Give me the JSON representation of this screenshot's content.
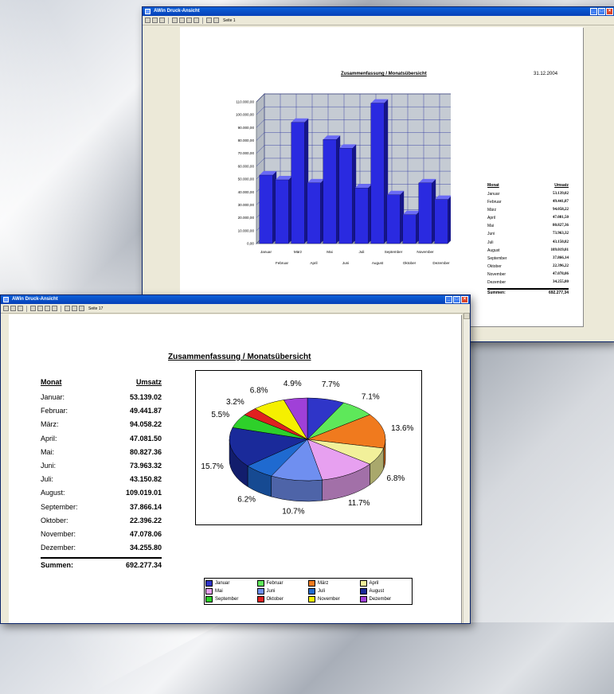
{
  "back_window": {
    "title": "AWin Druck-Ansicht",
    "page_label": "Seite 1",
    "report_title": "Zusammenfassung / Monatsübersicht",
    "date": "31.12.2004",
    "table": {
      "col_month": "Monat",
      "col_sales": "Umsatz",
      "rows": [
        {
          "month": "Januar",
          "value": "53.139,02"
        },
        {
          "month": "Februar",
          "value": "49.441,87"
        },
        {
          "month": "März",
          "value": "94.058,22"
        },
        {
          "month": "April",
          "value": "47.081,50"
        },
        {
          "month": "Mai",
          "value": "80.827,36"
        },
        {
          "month": "Juni",
          "value": "73.963,32"
        },
        {
          "month": "Juli",
          "value": "43.150,82"
        },
        {
          "month": "August",
          "value": "109.019,01"
        },
        {
          "month": "September",
          "value": "37.866,14"
        },
        {
          "month": "Oktober",
          "value": "22.396,22"
        },
        {
          "month": "November",
          "value": "47.078,06"
        },
        {
          "month": "Dezember",
          "value": "34.255,80"
        }
      ],
      "sum_label": "Summen:",
      "sum_value": "692.277,34"
    }
  },
  "front_window": {
    "title": "AWin Druck-Ansicht",
    "page_label": "Seite 17",
    "report_title": "Zusammenfassung / Monatsübersicht",
    "table": {
      "col_month": "Monat",
      "col_sales": "Umsatz",
      "rows": [
        {
          "month": "Januar:",
          "value": "53.139.02"
        },
        {
          "month": "Februar:",
          "value": "49.441.87"
        },
        {
          "month": "März:",
          "value": "94.058.22"
        },
        {
          "month": "April:",
          "value": "47.081.50"
        },
        {
          "month": "Mai:",
          "value": "80.827.36"
        },
        {
          "month": "Juni:",
          "value": "73.963.32"
        },
        {
          "month": "Juli:",
          "value": "43.150.82"
        },
        {
          "month": "August:",
          "value": "109.019.01"
        },
        {
          "month": "September:",
          "value": "37.866.14"
        },
        {
          "month": "Oktober:",
          "value": "22.396.22"
        },
        {
          "month": "November:",
          "value": "47.078.06"
        },
        {
          "month": "Dezember:",
          "value": "34.255.80"
        }
      ],
      "sum_label": "Summen:",
      "sum_value": "692.277.34"
    },
    "legend": [
      {
        "label": "Januar",
        "color": "#2f35c8"
      },
      {
        "label": "Februar",
        "color": "#5ee85a"
      },
      {
        "label": "März",
        "color": "#f07a1e"
      },
      {
        "label": "April",
        "color": "#f2f09a"
      },
      {
        "label": "Mai",
        "color": "#e7a0f0"
      },
      {
        "label": "Juni",
        "color": "#6f8ff0"
      },
      {
        "label": "Juli",
        "color": "#1f6ad0"
      },
      {
        "label": "August",
        "color": "#1a2a9a"
      },
      {
        "label": "September",
        "color": "#2ed02a"
      },
      {
        "label": "Oktober",
        "color": "#e02020"
      },
      {
        "label": "November",
        "color": "#f5f000"
      },
      {
        "label": "Dezember",
        "color": "#a040d8"
      }
    ]
  },
  "chart_data": [
    {
      "type": "bar",
      "categories": [
        "Januar",
        "Februar",
        "März",
        "April",
        "Mai",
        "Juni",
        "Juli",
        "August",
        "September",
        "Oktober",
        "November",
        "Dezember"
      ],
      "x_tick_labels_row1": [
        "Januar",
        "März",
        "Mai",
        "Juli",
        "September",
        "November"
      ],
      "x_tick_labels_row2": [
        "Februar",
        "April",
        "Juni",
        "August",
        "Oktober",
        "Dezember"
      ],
      "values": [
        53139.02,
        49441.87,
        94058.22,
        47081.5,
        80827.36,
        73963.32,
        43150.82,
        109019.01,
        37866.14,
        22396.22,
        47078.06,
        34255.8
      ],
      "y_ticks": [
        "0,00",
        "10.000,00",
        "20.000,00",
        "30.000,00",
        "40.000,00",
        "50.000,00",
        "60.000,00",
        "70.000,00",
        "80.000,00",
        "90.000,00",
        "100.000,00",
        "110.000,00"
      ],
      "ylim": [
        0,
        110000
      ],
      "grid": true,
      "color": "#2a2ae0"
    },
    {
      "type": "pie",
      "slices": [
        {
          "label": "Januar",
          "value": 7.7
        },
        {
          "label": "Februar",
          "value": 7.1
        },
        {
          "label": "März",
          "value": 13.6
        },
        {
          "label": "April",
          "value": 6.8
        },
        {
          "label": "Mai",
          "value": 11.7
        },
        {
          "label": "Juni",
          "value": 10.7
        },
        {
          "label": "Juli",
          "value": 6.2
        },
        {
          "label": "August",
          "value": 15.7
        },
        {
          "label": "September",
          "value": 5.5
        },
        {
          "label": "Oktober",
          "value": 3.2
        },
        {
          "label": "November",
          "value": 6.8
        },
        {
          "label": "Dezember",
          "value": 4.9
        }
      ],
      "percent_labels": [
        "7.7%",
        "7.1%",
        "13.6%",
        "6.8%",
        "11.7%",
        "10.7%",
        "6.2%",
        "15.7%",
        "5.5%",
        "3.2%",
        "6.8%",
        "4.9%"
      ]
    }
  ]
}
